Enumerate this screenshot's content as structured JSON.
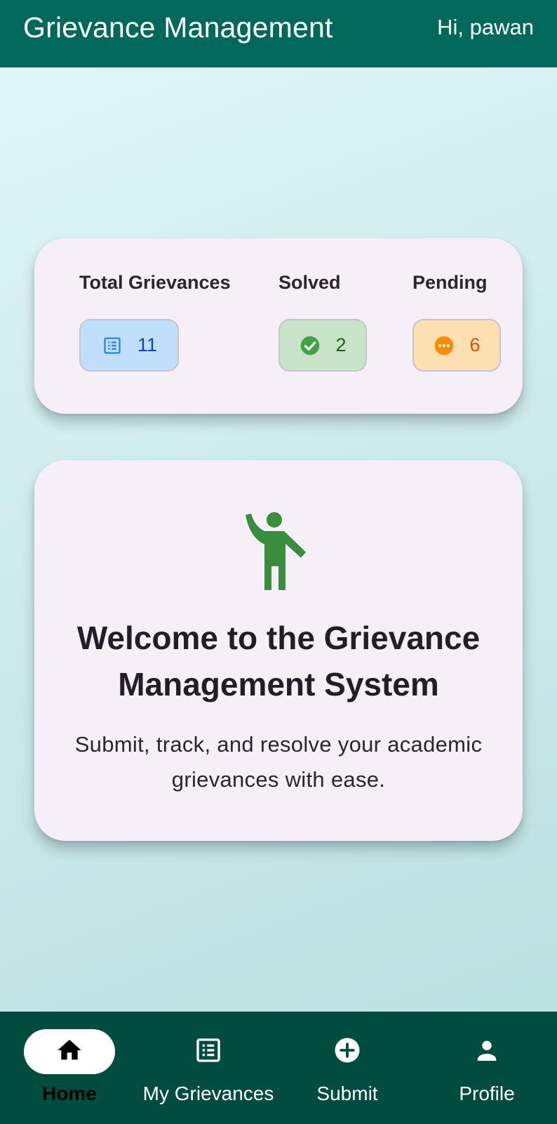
{
  "app_bar": {
    "title": "Grievance Management",
    "greeting": "Hi, pawan"
  },
  "stats": {
    "total": {
      "label": "Total Grievances",
      "value": "11",
      "icon": "list-alt-icon",
      "color": "#1e88e5"
    },
    "solved": {
      "label": "Solved",
      "value": "2",
      "icon": "check-circle-icon",
      "color": "#43a047"
    },
    "pending": {
      "label": "Pending",
      "value": "6",
      "icon": "pending-icon",
      "color": "#fb8c00"
    }
  },
  "welcome": {
    "icon": "waving-person-icon",
    "title": "Welcome to the Grievance Management System",
    "subtitle": "Submit, track, and resolve your academic grievances with ease."
  },
  "bottom_nav": {
    "items": [
      {
        "label": "Home",
        "icon": "home-icon",
        "active": true
      },
      {
        "label": "My Grievances",
        "icon": "list-alt-icon",
        "active": false
      },
      {
        "label": "Submit",
        "icon": "add-circle-icon",
        "active": false
      },
      {
        "label": "Profile",
        "icon": "person-icon",
        "active": false
      }
    ]
  },
  "colors": {
    "app_bar": "#00695c",
    "bottom_nav": "#004d40",
    "card": "#f6eff7",
    "accent_green": "#388e3c"
  }
}
